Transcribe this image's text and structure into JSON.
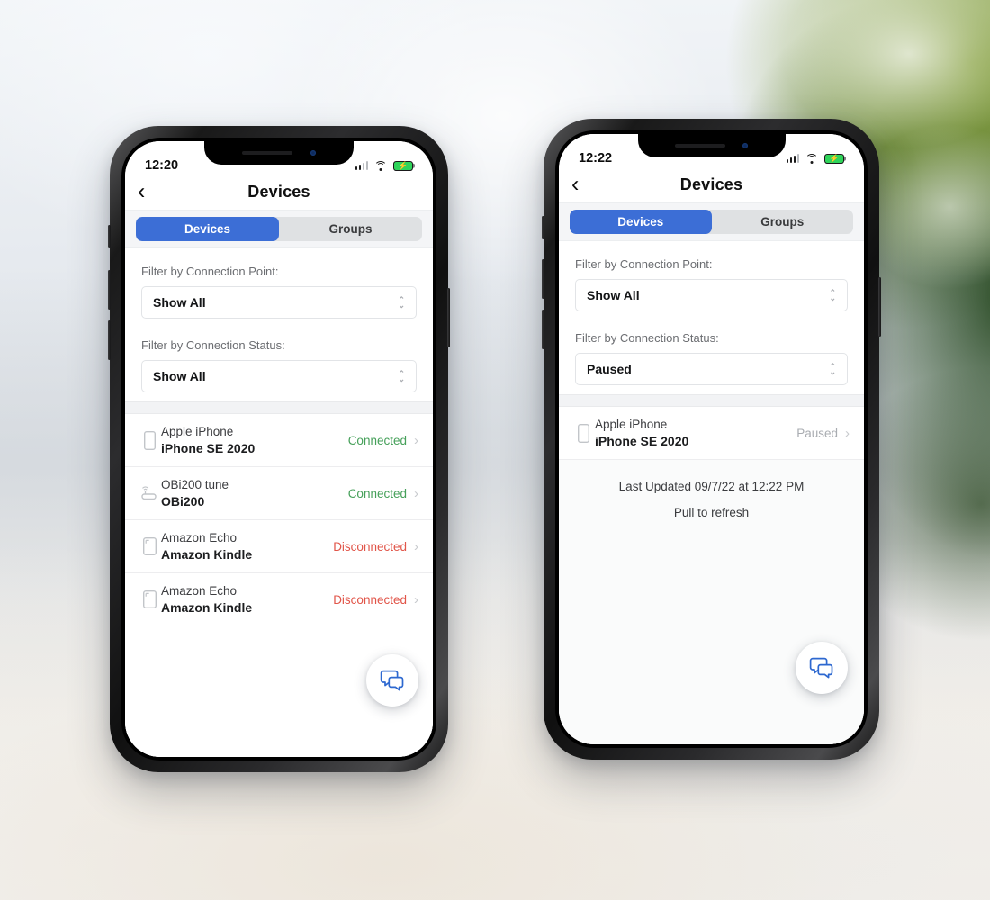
{
  "theme": {
    "accent_blue": "#3c6ed6",
    "status_connected": "#46a05a",
    "status_disconnected": "#e15549",
    "status_paused": "#a9acb1",
    "battery_green": "#2fd45a"
  },
  "phones": [
    {
      "id": "left",
      "status_bar": {
        "time": "12:20",
        "signal_icon": "signal-bars-icon",
        "wifi_icon": "wifi-icon",
        "battery_icon": "battery-charging-icon"
      },
      "nav": {
        "back_icon": "chevron-left-icon",
        "title": "Devices"
      },
      "segmented": {
        "options": [
          "Devices",
          "Groups"
        ],
        "selected": "Devices"
      },
      "filters": [
        {
          "label": "Filter by Connection Point:",
          "value": "Show All"
        },
        {
          "label": "Filter by Connection Status:",
          "value": "Show All"
        }
      ],
      "devices": [
        {
          "icon": "phone-icon",
          "name": "Apple iPhone",
          "model": "iPhone SE 2020",
          "status": "Connected",
          "status_kind": "connected"
        },
        {
          "icon": "router-icon",
          "name": "OBi200 tune",
          "model": "OBi200",
          "status": "Connected",
          "status_kind": "connected"
        },
        {
          "icon": "tablet-icon",
          "name": "Amazon Echo",
          "model": "Amazon Kindle",
          "status": "Disconnected",
          "status_kind": "disconnected"
        },
        {
          "icon": "tablet-icon",
          "name": "Amazon Echo",
          "model": "Amazon Kindle",
          "status": "Disconnected",
          "status_kind": "disconnected"
        }
      ],
      "footer": null,
      "fab": {
        "icon": "chat-bubbles-icon"
      }
    },
    {
      "id": "right",
      "status_bar": {
        "time": "12:22",
        "signal_icon": "signal-bars-icon",
        "wifi_icon": "wifi-icon",
        "battery_icon": "battery-charging-icon"
      },
      "nav": {
        "back_icon": "chevron-left-icon",
        "title": "Devices"
      },
      "segmented": {
        "options": [
          "Devices",
          "Groups"
        ],
        "selected": "Devices"
      },
      "filters": [
        {
          "label": "Filter by Connection Point:",
          "value": "Show All"
        },
        {
          "label": "Filter by Connection Status:",
          "value": "Paused"
        }
      ],
      "devices": [
        {
          "icon": "phone-icon",
          "name": "Apple iPhone",
          "model": "iPhone SE 2020",
          "status": "Paused",
          "status_kind": "paused"
        }
      ],
      "footer": {
        "last_updated": "Last Updated 09/7/22 at 12:22 PM",
        "hint": "Pull to refresh"
      },
      "fab": {
        "icon": "chat-bubbles-icon"
      }
    }
  ]
}
